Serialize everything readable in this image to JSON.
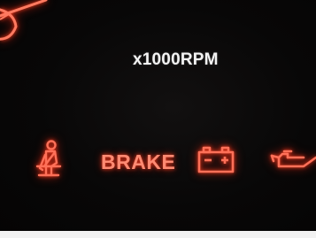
{
  "display": {
    "rpm_unit_label": "x1000RPM",
    "brake_label": "BRAKE"
  },
  "indicators": [
    {
      "name": "seatbelt-warning",
      "icon": "seatbelt-icon",
      "state": "on"
    },
    {
      "name": "brake-warning",
      "icon": "brake-text",
      "state": "on"
    },
    {
      "name": "battery-warning",
      "icon": "battery-icon",
      "state": "on"
    },
    {
      "name": "oil-pressure-warning",
      "icon": "oil-can-icon",
      "state": "on"
    }
  ],
  "colors": {
    "background": "#080707",
    "warning_red": "#ff5a3c",
    "needle_red": "#ff6a50",
    "label_white": "#f3f3f3"
  }
}
